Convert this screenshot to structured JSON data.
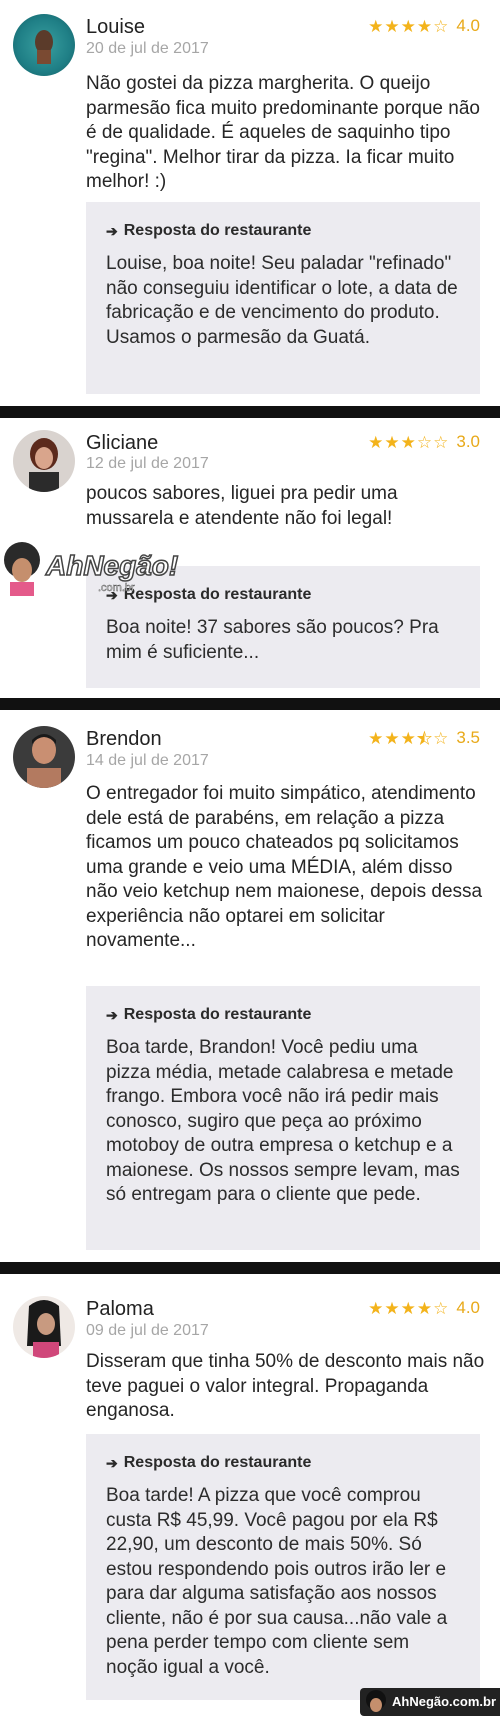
{
  "colors": {
    "star": "#f3b31b",
    "score": "#e8a919",
    "reply_bg": "#ecebf0",
    "separator": "#111111",
    "date": "#a6a6a6"
  },
  "reviews": [
    {
      "name": "Louise",
      "date": "20 de jul de 2017",
      "rating": "4.0",
      "stars": "4 of 5",
      "text": "Não gostei da pizza margherita. O queijo parmesão fica muito predominante porque não é de qualidade. É aqueles de saquinho tipo \"regina\". Melhor tirar da pizza. Ia ficar muito melhor! :)",
      "reply_label": "Resposta do restaurante",
      "reply_text": "Louise, boa noite! Seu paladar \"refinado\" não conseguiu identificar o lote, a data de fabricação e de vencimento do produto. Usamos o parmesão da Guatá."
    },
    {
      "name": "Gliciane",
      "date": "12 de jul de 2017",
      "rating": "3.0",
      "stars": "3 of 5",
      "text": "poucos sabores, liguei pra pedir uma mussarela e atendente não foi legal!",
      "reply_label": "Resposta do restaurante",
      "reply_text": "Boa noite! 37 sabores são poucos? Pra mim é suficiente..."
    },
    {
      "name": "Brendon",
      "date": "14 de jul de 2017",
      "rating": "3.5",
      "stars": "3.5 of 5",
      "text": "O entregador foi muito simpático, atendimento dele está de parabéns, em relação a pizza ficamos um pouco chateados pq solicitamos uma grande e veio uma MÉDIA, além disso não veio ketchup nem maionese, depois dessa experiência não optarei em solicitar novamente...",
      "reply_label": "Resposta do restaurante",
      "reply_text": "Boa tarde, Brandon! Você pediu uma pizza média, metade calabresa e metade frango. Embora você não irá pedir mais conosco, sugiro que peça ao próximo motoboy de outra empresa o ketchup e a maionese. Os nossos sempre levam, mas só entregam para o cliente que pede."
    },
    {
      "name": "Paloma",
      "date": "09 de jul de 2017",
      "rating": "4.0",
      "stars": "4 of 5",
      "text": "Disseram que tinha 50% de desconto mais não teve paguei o valor integral. Propaganda enganosa.",
      "reply_label": "Resposta do restaurante",
      "reply_text": "Boa tarde! A pizza que você comprou custa R$ 45,99. Você pagou por ela R$ 22,90, um desconto de mais 50%. Só estou respondendo pois outros irão ler e para dar alguma satisfação aos nossos cliente, não é por sua causa...não vale a pena perder tempo com cliente sem noção igual a você."
    }
  ],
  "watermark": {
    "text": "AhNegão!",
    "sub": ".com.br"
  },
  "footer_brand": "AhNegão.com.br"
}
